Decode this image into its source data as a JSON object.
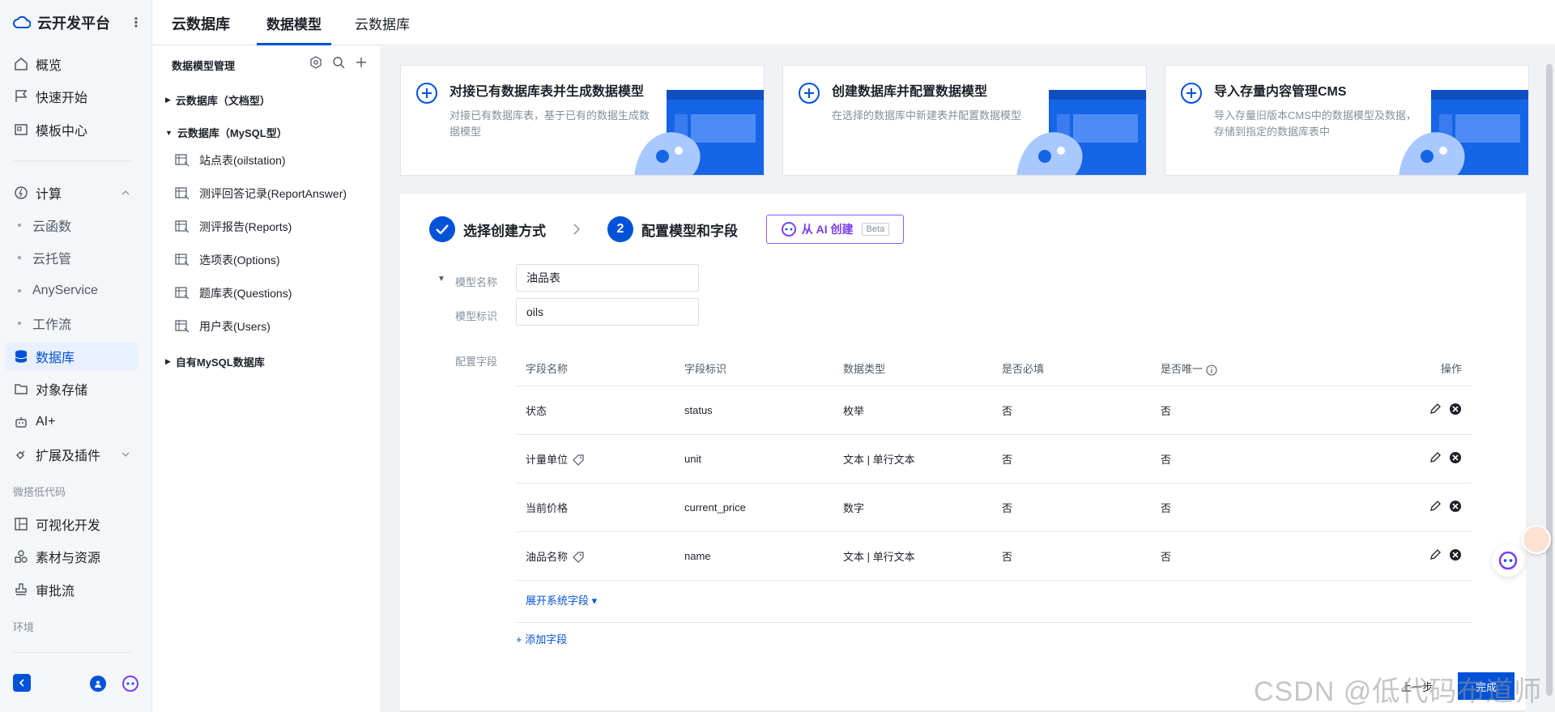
{
  "brand": {
    "name": "云开发平台"
  },
  "sidebar": {
    "items": [
      {
        "label": "概览"
      },
      {
        "label": "快速开始"
      },
      {
        "label": "模板中心"
      }
    ],
    "compute": {
      "label": "计算",
      "children": [
        "云函数",
        "云托管",
        "AnyService",
        "工作流"
      ]
    },
    "items2": [
      {
        "label": "数据库"
      },
      {
        "label": "对象存储"
      },
      {
        "label": "AI+"
      },
      {
        "label": "扩展及插件"
      }
    ],
    "group_lowcode": "微搭低代码",
    "items3": [
      {
        "label": "可视化开发"
      },
      {
        "label": "素材与资源"
      },
      {
        "label": "审批流"
      }
    ],
    "group_env": "环境"
  },
  "topbar": {
    "title": "云数据库",
    "tabs": [
      "数据模型",
      "云数据库"
    ]
  },
  "tree": {
    "title": "数据模型管理",
    "nodes": [
      {
        "label": "云数据库（文档型）"
      },
      {
        "label": "云数据库（MySQL型）"
      },
      {
        "label": "自有MySQL数据库"
      }
    ],
    "leaves": [
      "站点表(oilstation)",
      "测评回答记录(ReportAnswer)",
      "测评报告(Reports)",
      "选项表(Options)",
      "题库表(Questions)",
      "用户表(Users)"
    ]
  },
  "cards": [
    {
      "title": "对接已有数据库表并生成数据模型",
      "desc": "对接已有数据库表，基于已有的数据生成数据模型"
    },
    {
      "title": "创建数据库并配置数据模型",
      "desc": "在选择的数据库中新建表并配置数据模型"
    },
    {
      "title": "导入存量内容管理CMS",
      "desc": "导入存量旧版本CMS中的数据模型及数据，存储到指定的数据库表中"
    }
  ],
  "steps": {
    "step1": "选择创建方式",
    "step2_num": "2",
    "step2": "配置模型和字段"
  },
  "ai_button": {
    "label": "从 AI 创建",
    "badge": "Beta"
  },
  "form": {
    "model_name_label": "模型名称",
    "model_name_value": "油品表",
    "model_id_label": "模型标识",
    "model_id_value": "oils",
    "fields_label": "配置字段"
  },
  "table": {
    "headers": [
      "字段名称",
      "字段标识",
      "数据类型",
      "是否必填",
      "是否唯一",
      "操作"
    ],
    "rows": [
      {
        "name": "状态",
        "id": "status",
        "type": "枚举",
        "required": "否",
        "unique": "否"
      },
      {
        "name": "计量单位",
        "id": "unit",
        "type": "文本 | 单行文本",
        "required": "否",
        "unique": "否"
      },
      {
        "name": "当前价格",
        "id": "current_price",
        "type": "数字",
        "required": "否",
        "unique": "否"
      },
      {
        "name": "油品名称",
        "id": "name",
        "type": "文本 | 单行文本",
        "required": "否",
        "unique": "否"
      }
    ],
    "expand_label": "展开系统字段 ▾",
    "add_label": "+ 添加字段"
  },
  "footer": {
    "prev": "上一步",
    "done": "完成"
  },
  "watermark": "CSDN @低代码布道师",
  "colors": {
    "primary": "#0052d9",
    "ai_purple": "#7a3ef2"
  }
}
